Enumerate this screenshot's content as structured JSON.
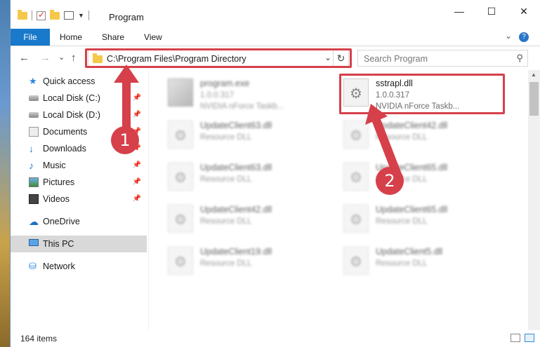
{
  "window": {
    "title": "Program",
    "controls": {
      "minimize": "—",
      "maximize": "☐",
      "close": "✕"
    }
  },
  "ribbon": {
    "tabs": [
      "File",
      "Home",
      "Share",
      "View"
    ]
  },
  "navigation": {
    "back": "←",
    "forward": "→",
    "recent": "⌄",
    "up": "↑",
    "address": "C:\\Program Files\\Program Directory",
    "search_placeholder": "Search Program"
  },
  "sidebar": {
    "items": [
      {
        "label": "Quick access",
        "icon": "star-icon",
        "pinned": false
      },
      {
        "label": "Local Disk (C:)",
        "icon": "disk-icon",
        "pinned": true
      },
      {
        "label": "Local Disk (D:)",
        "icon": "disk-icon",
        "pinned": true
      },
      {
        "label": "Documents",
        "icon": "documents-icon",
        "pinned": true
      },
      {
        "label": "Downloads",
        "icon": "download-icon",
        "pinned": true
      },
      {
        "label": "Music",
        "icon": "music-icon",
        "pinned": true
      },
      {
        "label": "Pictures",
        "icon": "pictures-icon",
        "pinned": true
      },
      {
        "label": "Videos",
        "icon": "videos-icon",
        "pinned": true
      },
      {
        "label": "OneDrive",
        "icon": "cloud-icon",
        "pinned": false
      },
      {
        "label": "This PC",
        "icon": "pc-icon",
        "pinned": false
      },
      {
        "label": "Network",
        "icon": "network-icon",
        "pinned": false
      }
    ]
  },
  "files": [
    {
      "name": "program.exe",
      "line1": "1.0.0.317",
      "line2": "NVIDIA nForce Taskb...",
      "blurred": true
    },
    {
      "name": "sstrapl.dll",
      "line1": "1.0.0.317",
      "line2": "NVIDIA nForce Taskb...",
      "blurred": false
    },
    {
      "name": "UpdateClient63.dll",
      "line1": "Resource DLL",
      "blurred": true
    },
    {
      "name": "UpdateClient42.dll",
      "line1": "Resource DLL",
      "blurred": true
    },
    {
      "name": "UpdateClient63.dll",
      "line1": "Resource DLL",
      "blurred": true
    },
    {
      "name": "UpdateClient65.dll",
      "line1": "Resource DLL",
      "blurred": true
    },
    {
      "name": "UpdateClient42.dll",
      "line1": "Resource DLL",
      "blurred": true
    },
    {
      "name": "UpdateClient65.dll",
      "line1": "Resource DLL",
      "blurred": true
    },
    {
      "name": "UpdateClient19.dll",
      "line1": "Resource DLL",
      "blurred": true
    },
    {
      "name": "UpdateClient5.dll",
      "line1": "Resource DLL",
      "blurred": true
    }
  ],
  "status": {
    "item_count": "164 items"
  },
  "annotations": {
    "step1": "1",
    "step2": "2"
  },
  "colors": {
    "accent": "#1979ca",
    "highlight": "#d6404a",
    "selected": "#d9d9d9"
  }
}
